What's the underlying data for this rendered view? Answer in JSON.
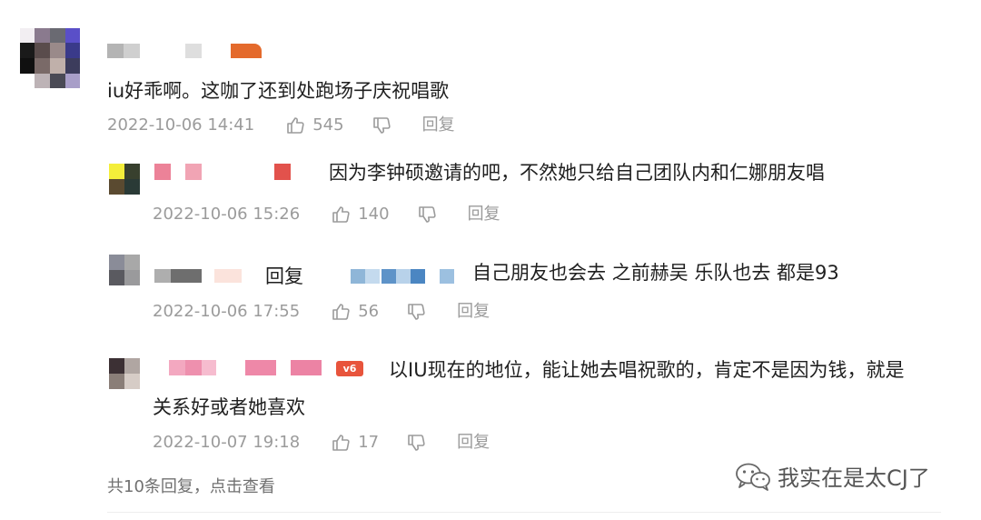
{
  "comment": {
    "text": "iu好乖啊。这咖了还到处跑场子庆祝唱歌",
    "time": "2022-10-06 14:41",
    "likes": "545",
    "reply_label": "回复"
  },
  "replies": [
    {
      "text": "因为李钟硕邀请的吧，不然她只给自己团队内和仁娜朋友唱",
      "time": "2022-10-06 15:26",
      "likes": "140",
      "reply_label": "回复"
    },
    {
      "reply_word": "回复",
      "text": "自己朋友也会去   之前赫吴  乐队也去  都是93",
      "time": "2022-10-06 17:55",
      "likes": "56",
      "reply_label": "回复"
    },
    {
      "badge": "v6",
      "text_line1": "以IU现在的地位，能让她去唱祝歌的，肯定不是因为钱，就是",
      "text_line2": "关系好或者她喜欢",
      "time": "2022-10-07 19:18",
      "likes": "17",
      "reply_label": "回复"
    }
  ],
  "footer": {
    "view_replies": "共10条回复，点击查看"
  },
  "watermark": {
    "text": "我实在是太CJ了",
    "icon": "wechat-icon"
  },
  "colors": {
    "meta_gray": "#9b9b9b",
    "text": "#1f1f1f",
    "badge_red": "#e8543c"
  }
}
